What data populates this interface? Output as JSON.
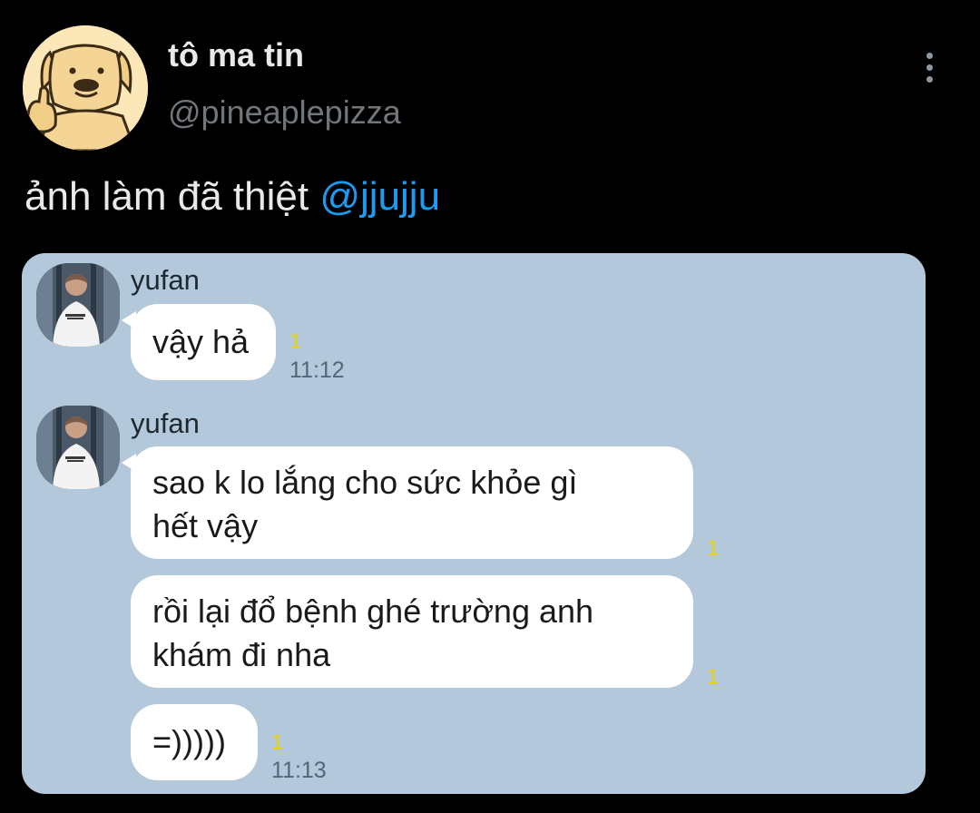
{
  "tweet": {
    "display_name": "tô ma tin",
    "handle": "@pineaplepizza",
    "text": "ảnh làm đã thiệt ",
    "mention": "@jjujju"
  },
  "icons": {
    "more": "more-vertical-icon",
    "avatar": "dog-thumbs-up-avatar"
  },
  "colors": {
    "background": "#000000",
    "link": "#1d9bf0",
    "chat_background": "#b3c8da",
    "bubble": "#ffffff",
    "unread_count": "#e6d400"
  },
  "chat": {
    "groups": [
      {
        "sender": "yufan",
        "messages": [
          {
            "lines": [
              "vậy hả"
            ],
            "unread": "1",
            "time": "11:12"
          }
        ]
      },
      {
        "sender": "yufan",
        "messages": [
          {
            "lines": [
              "sao k lo lắng cho sức khỏe gì",
              "hết vậy"
            ],
            "unread": "1",
            "time": ""
          },
          {
            "lines": [
              "rồi lại đổ bệnh ghé trường anh",
              "khám đi nha"
            ],
            "unread": "1",
            "time": ""
          },
          {
            "lines": [
              "=)))))"
            ],
            "unread": "1",
            "time": "11:13"
          }
        ]
      }
    ]
  }
}
